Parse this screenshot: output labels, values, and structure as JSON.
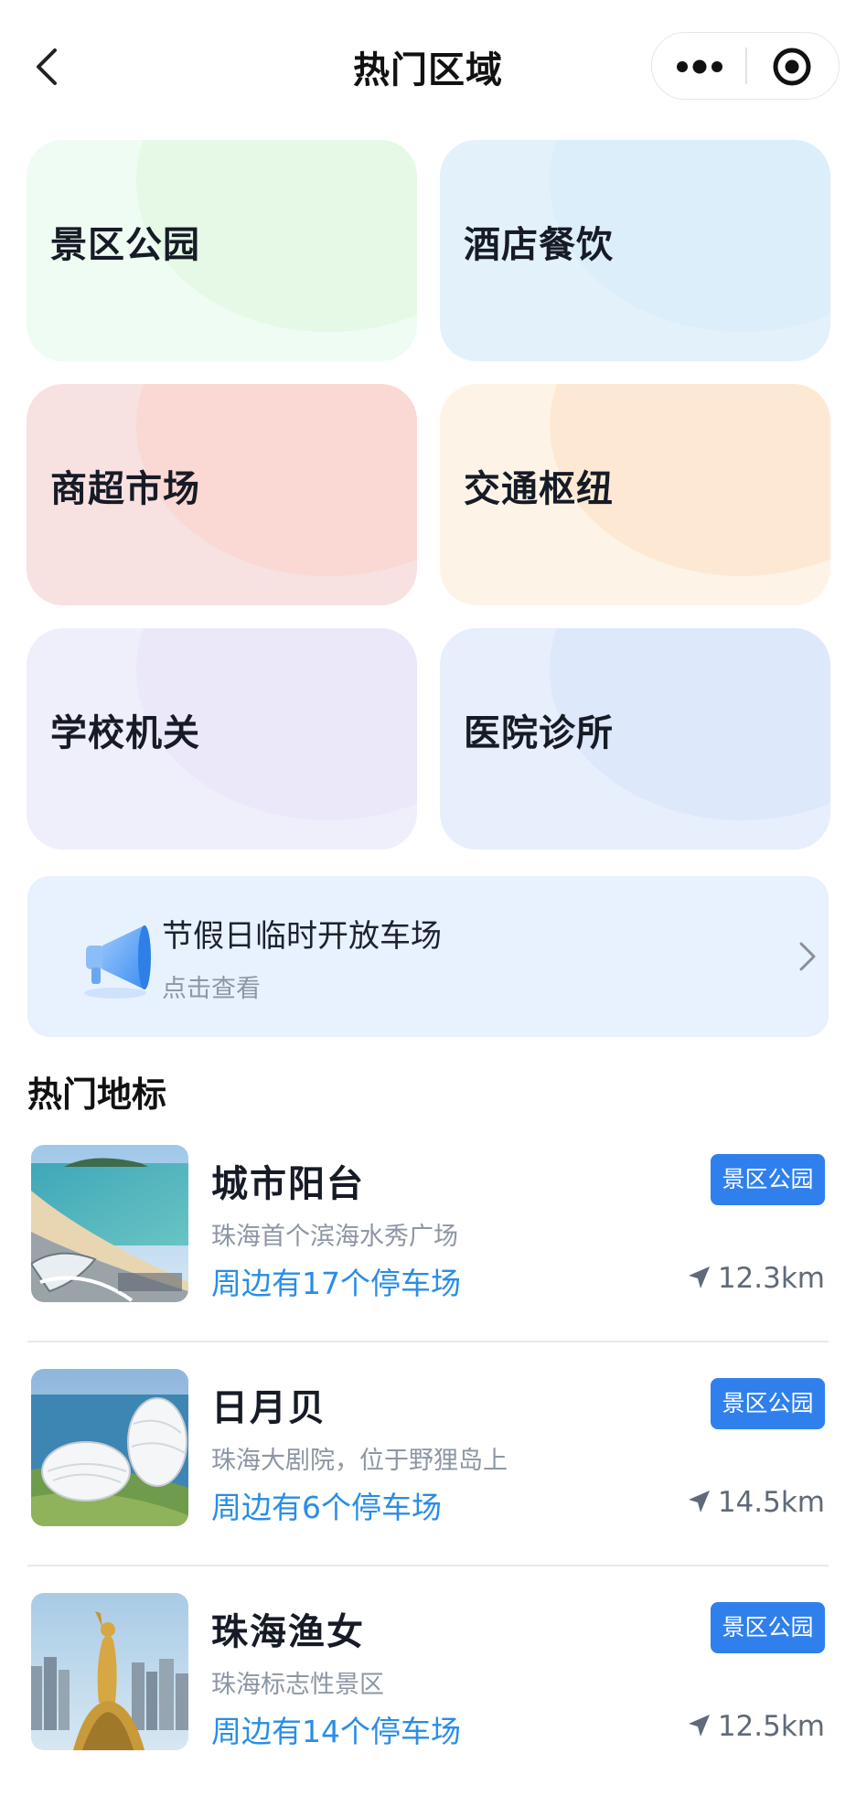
{
  "navbar": {
    "title": "热门区域",
    "back_icon": "chevron-left-icon",
    "more_icon": "more-dots-icon",
    "close_icon": "target-circle-icon"
  },
  "categories": [
    {
      "label": "景区公园",
      "bg": "#eefcf3",
      "blob": "#e5f9e6"
    },
    {
      "label": "酒店餐饮",
      "bg": "#e3f1fb",
      "blob": "#dbeefa"
    },
    {
      "label": "商超市场",
      "bg": "#f8e1e1",
      "blob": "#fad8d3"
    },
    {
      "label": "交通枢纽",
      "bg": "#fdf4e7",
      "blob": "#fde9d3"
    },
    {
      "label": "学校机关",
      "bg": "#efeefb",
      "blob": "#ebe8fa"
    },
    {
      "label": "医院诊所",
      "bg": "#e7eefc",
      "blob": "#dde8fa"
    }
  ],
  "notice": {
    "title": "节假日临时开放车场",
    "subtitle": "点击查看",
    "icon": "megaphone-icon"
  },
  "section_title": "热门地标",
  "landmarks": [
    {
      "name": "城市阳台",
      "desc": "珠海首个滨海水秀广场",
      "parking": "周边有17个停车场",
      "tag": "景区公园",
      "distance": "12.3km"
    },
    {
      "name": "日月贝",
      "desc": "珠海大剧院，位于野狸岛上",
      "parking": "周边有6个停车场",
      "tag": "景区公园",
      "distance": "14.5km"
    },
    {
      "name": "珠海渔女",
      "desc": "珠海标志性景区",
      "parking": "周边有14个停车场",
      "tag": "景区公园",
      "distance": "12.5km"
    }
  ],
  "colors": {
    "accent": "#2f80ed",
    "link": "#2a8de6",
    "notice_bg": "#e8f1fe"
  }
}
